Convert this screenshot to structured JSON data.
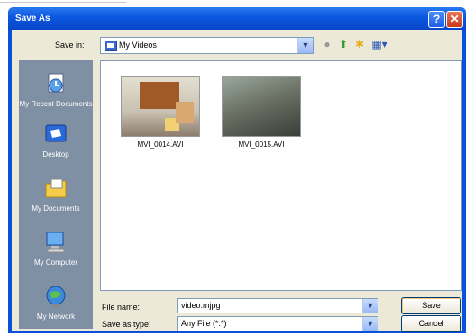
{
  "window": {
    "title": "Save As"
  },
  "toolbar": {
    "save_in_label": "Save in:",
    "save_in_value": "My Videos"
  },
  "places": [
    {
      "label": "My Recent Documents"
    },
    {
      "label": "Desktop"
    },
    {
      "label": "My Documents"
    },
    {
      "label": "My Computer"
    },
    {
      "label": "My Network"
    }
  ],
  "files": [
    {
      "name": "MVI_0014.AVI"
    },
    {
      "name": "MVI_0015.AVI"
    }
  ],
  "form": {
    "file_name_label": "File name:",
    "file_name_value": "video.mjpg",
    "save_as_type_label": "Save as type:",
    "save_as_type_value": "Any File (*.*)",
    "save_label": "Save",
    "cancel_label": "Cancel"
  },
  "colors": {
    "titlebar": "#0a50d8",
    "places_bar": "#7f8fa4",
    "dialog_bg": "#ece9d8"
  }
}
